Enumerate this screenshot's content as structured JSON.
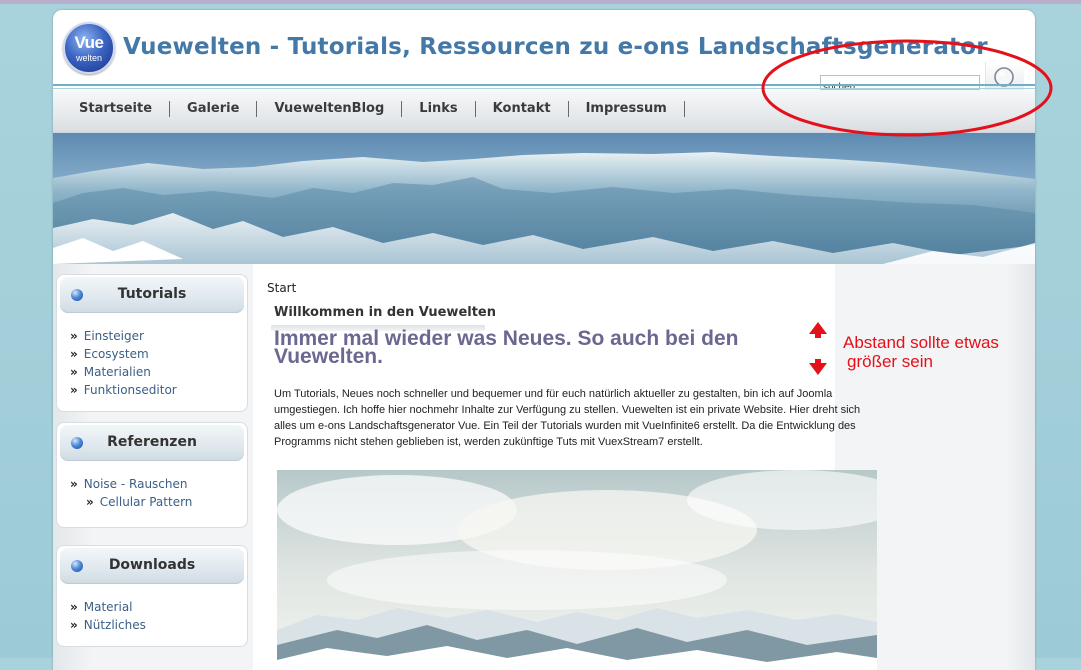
{
  "header": {
    "logo_main": "Vue",
    "logo_sub": "welten",
    "site_title": "Vuewelten - Tutorials, Ressourcen zu e-ons Landschaftsgenerator",
    "search_value": "suchen"
  },
  "nav": {
    "items": [
      "Startseite",
      "Galerie",
      "VueweltenBlog",
      "Links",
      "Kontakt",
      "Impressum"
    ]
  },
  "sidebar": {
    "boxes": [
      {
        "title": "Tutorials",
        "items": [
          "Einsteiger",
          "Ecosystem",
          "Materialien",
          "Funktionseditor"
        ]
      },
      {
        "title": "Referenzen",
        "items": [
          "Noise - Rauschen",
          "Cellular Pattern"
        ]
      },
      {
        "title": "Downloads",
        "items": [
          "Material",
          "Nützliches"
        ]
      }
    ]
  },
  "main": {
    "breadcrumb": "Start",
    "welcome_title": "Willkommen in den Vuewelten",
    "headline": "Immer mal wieder was Neues. So auch bei den Vuewelten.",
    "body": "Um Tutorials, Neues noch schneller und bequemer und für euch natürlich aktueller zu gestalten, bin ich auf Joomla umgestiegen. Ich hoffe hier nochmehr Inhalte zur Verfügung zu stellen. Vuewelten ist ein private Website. Hier dreht sich alles um e-ons Landschaftsgenerator Vue. Ein Teil der Tutorials wurden mit VueInfinite6 erstellt. Da die Entwicklung des Programms nicht stehen geblieben ist, werden zukünftige Tuts mit VuexStream7 erstellt."
  },
  "annotation": {
    "line1": "Abstand sollte etwas",
    "line2": "größer sein",
    "color": "#e4101a"
  },
  "colors": {
    "title": "#4378a7",
    "headline": "#6a6891",
    "link": "#3b5f86",
    "page_bg": "#a9d3dc"
  }
}
